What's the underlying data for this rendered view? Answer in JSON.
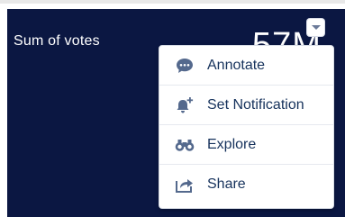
{
  "card": {
    "metric_label": "Sum of votes",
    "metric_value": "57M"
  },
  "menu_trigger": {
    "icon": "chevron-down-icon"
  },
  "menu": {
    "items": [
      {
        "label": "Annotate",
        "icon": "comment-icon"
      },
      {
        "label": "Set Notification",
        "icon": "bell-add-icon"
      },
      {
        "label": "Explore",
        "icon": "binoculars-icon"
      },
      {
        "label": "Share",
        "icon": "share-icon"
      }
    ]
  },
  "colors": {
    "card_background": "#0b1742",
    "menu_text": "#16325c",
    "menu_icon": "#54698d",
    "bar": "#c9c7ea"
  }
}
